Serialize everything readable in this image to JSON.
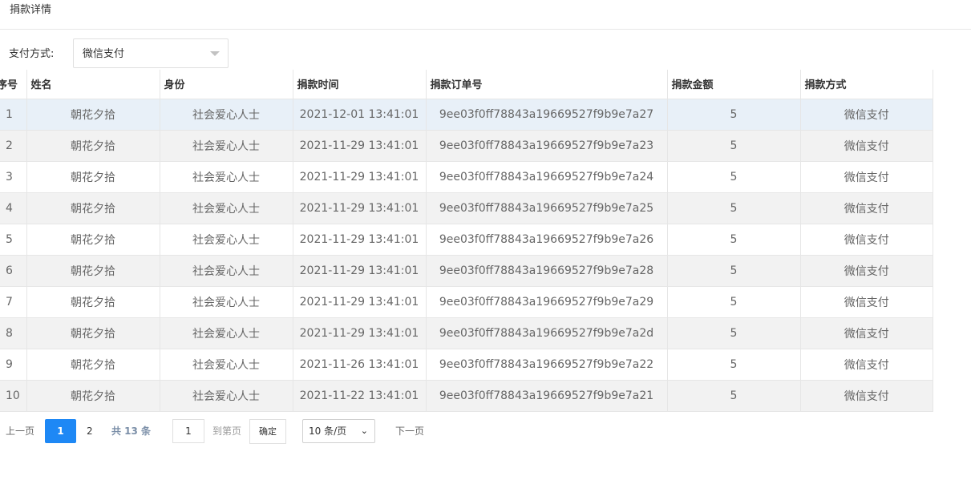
{
  "header": {
    "title": "捐款详情"
  },
  "filter": {
    "label": "支付方式:",
    "value": "微信支付"
  },
  "table": {
    "columns": [
      "序号",
      "姓名",
      "身份",
      "捐款时间",
      "捐款订单号",
      "捐款金额",
      "捐款方式"
    ],
    "rows": [
      [
        "1",
        "朝花夕拾",
        "社会爱心人士",
        "2021-12-01 13:41:01",
        "9ee03f0ff78843a19669527f9b9e7a27",
        "5",
        "微信支付"
      ],
      [
        "2",
        "朝花夕拾",
        "社会爱心人士",
        "2021-11-29 13:41:01",
        "9ee03f0ff78843a19669527f9b9e7a23",
        "5",
        "微信支付"
      ],
      [
        "3",
        "朝花夕拾",
        "社会爱心人士",
        "2021-11-29 13:41:01",
        "9ee03f0ff78843a19669527f9b9e7a24",
        "5",
        "微信支付"
      ],
      [
        "4",
        "朝花夕拾",
        "社会爱心人士",
        "2021-11-29 13:41:01",
        "9ee03f0ff78843a19669527f9b9e7a25",
        "5",
        "微信支付"
      ],
      [
        "5",
        "朝花夕拾",
        "社会爱心人士",
        "2021-11-29 13:41:01",
        "9ee03f0ff78843a19669527f9b9e7a26",
        "5",
        "微信支付"
      ],
      [
        "6",
        "朝花夕拾",
        "社会爱心人士",
        "2021-11-29 13:41:01",
        "9ee03f0ff78843a19669527f9b9e7a28",
        "5",
        "微信支付"
      ],
      [
        "7",
        "朝花夕拾",
        "社会爱心人士",
        "2021-11-29 13:41:01",
        "9ee03f0ff78843a19669527f9b9e7a29",
        "5",
        "微信支付"
      ],
      [
        "8",
        "朝花夕拾",
        "社会爱心人士",
        "2021-11-29 13:41:01",
        "9ee03f0ff78843a19669527f9b9e7a2d",
        "5",
        "微信支付"
      ],
      [
        "9",
        "朝花夕拾",
        "社会爱心人士",
        "2021-11-26 13:41:01",
        "9ee03f0ff78843a19669527f9b9e7a22",
        "5",
        "微信支付"
      ],
      [
        "10",
        "朝花夕拾",
        "社会爱心人士",
        "2021-11-22 13:41:01",
        "9ee03f0ff78843a19669527f9b9e7a21",
        "5",
        "微信支付"
      ]
    ]
  },
  "pagination": {
    "prev_label": "上一页",
    "current_page": "1",
    "page_2": "2",
    "total_label": "共 13 条",
    "goto_value": "1",
    "goto_label": "到第页",
    "confirm_label": "确定",
    "page_size_label": "10 条/页",
    "page_size_chevron": "⌄",
    "next_label": "下一页"
  },
  "colors": {
    "accent": "#1e88f5",
    "selected_row": "#e8f0f8",
    "striped_row": "#f2f2f2"
  }
}
